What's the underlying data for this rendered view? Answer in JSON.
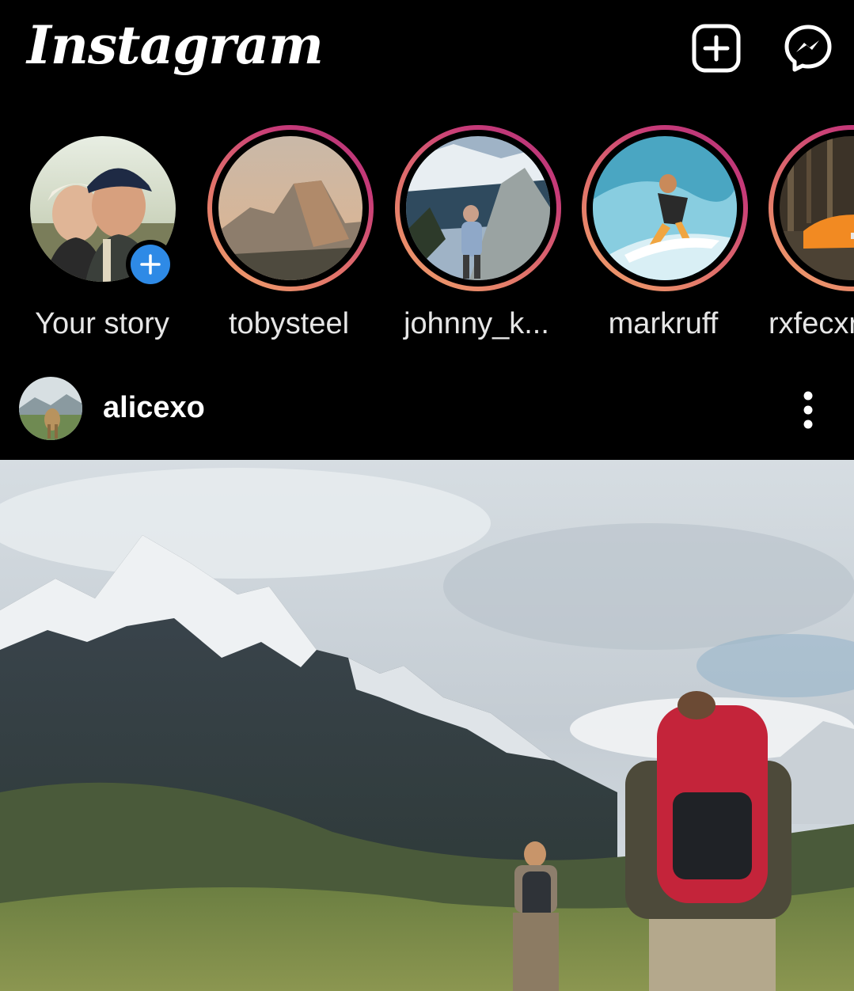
{
  "header": {
    "logo": "Instagram",
    "new_post_icon": "plus-square-icon",
    "messenger_icon": "messenger-icon"
  },
  "stories": [
    {
      "username": "Your story",
      "is_own": true
    },
    {
      "username": "tobysteel"
    },
    {
      "username": "johnny_k..."
    },
    {
      "username": "markruff"
    },
    {
      "username": "rxfecxr"
    }
  ],
  "post": {
    "username": "alicexo",
    "more_icon": "more-vertical-icon"
  },
  "colors": {
    "background": "#000000",
    "story_ring_start": "#f2a66b",
    "story_ring_end": "#b23478",
    "add_story_blue": "#2e8ae6"
  }
}
